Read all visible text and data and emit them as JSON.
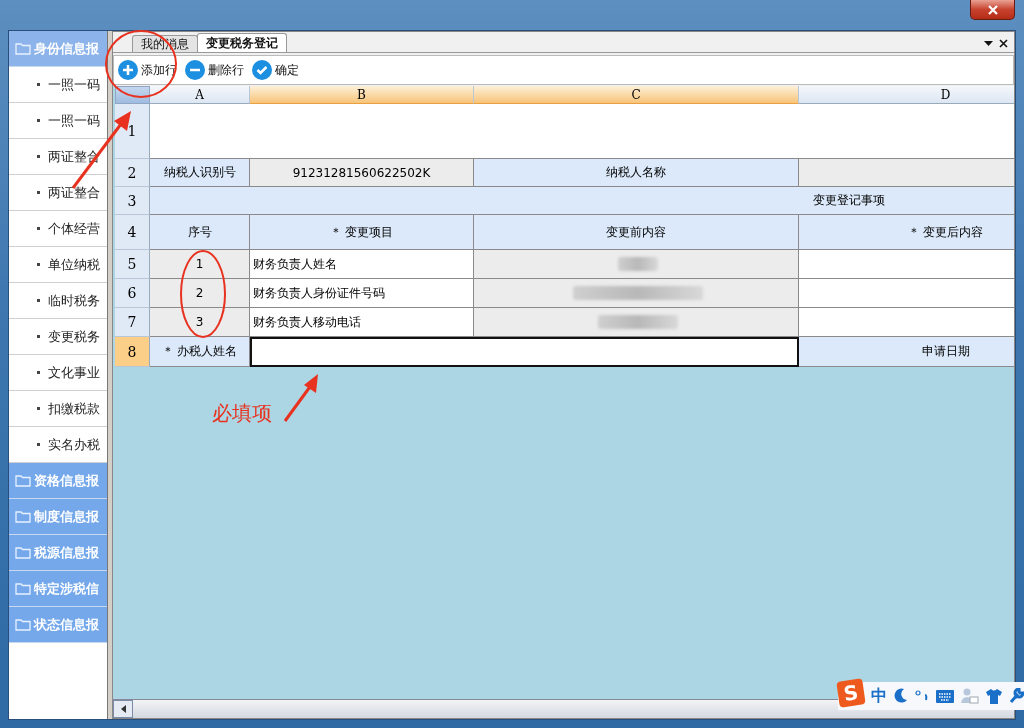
{
  "sidebar": {
    "groups": [
      {
        "label": "身份信息报",
        "expanded": true,
        "items": [
          "一照一码",
          "一照一码",
          "两证整合",
          "两证整合",
          "个体经营",
          "单位纳税",
          "临时税务",
          "变更税务",
          "文化事业",
          "扣缴税款",
          "实名办税"
        ]
      },
      {
        "label": "资格信息报",
        "expanded": false
      },
      {
        "label": "制度信息报",
        "expanded": false
      },
      {
        "label": "税源信息报",
        "expanded": false
      },
      {
        "label": "特定涉税信",
        "expanded": false
      },
      {
        "label": "状态信息报",
        "expanded": false
      }
    ]
  },
  "tabs": [
    {
      "label": "我的消息",
      "selected": false
    },
    {
      "label": "变更税务登记",
      "selected": true
    }
  ],
  "toolbar": [
    {
      "label": "添加行",
      "kind": "add"
    },
    {
      "label": "删除行",
      "kind": "remove"
    },
    {
      "label": "确定",
      "kind": "confirm"
    }
  ],
  "sheet": {
    "columns": [
      {
        "label": "A",
        "selected": false
      },
      {
        "label": "B",
        "selected": true
      },
      {
        "label": "C",
        "selected": true
      },
      {
        "label": "D",
        "selected": false
      }
    ],
    "rows": [
      {
        "label": "1",
        "selected": false,
        "cells": [
          {
            "kind": "blank"
          },
          {
            "kind": "merged"
          },
          {
            "kind": "merged"
          },
          {
            "kind": "merged"
          }
        ]
      },
      {
        "label": "2",
        "selected": false,
        "cells": [
          {
            "kind": "header",
            "text": "纳税人识别号"
          },
          {
            "kind": "data",
            "text": "91231281560622502K"
          },
          {
            "kind": "header",
            "text": "纳税人名称"
          },
          {
            "kind": "data"
          }
        ]
      },
      {
        "label": "3",
        "selected": false,
        "cells": [
          {
            "kind": "band"
          },
          {
            "kind": "merged"
          },
          {
            "kind": "merged"
          },
          {
            "kind": "title",
            "text": "变更登记事项"
          }
        ]
      },
      {
        "label": "4",
        "selected": false,
        "cells": [
          {
            "kind": "header",
            "text": "序号"
          },
          {
            "kind": "header",
            "text": "＊ 变更项目"
          },
          {
            "kind": "header",
            "text": "变更前内容"
          },
          {
            "kind": "header",
            "text": "＊ 变更后内容"
          }
        ]
      },
      {
        "label": "5",
        "selected": false,
        "cells": [
          {
            "kind": "data",
            "text": "1"
          },
          {
            "kind": "input",
            "text": "财务负责人姓名"
          },
          {
            "kind": "blurred"
          },
          {
            "kind": "input"
          }
        ]
      },
      {
        "label": "6",
        "selected": false,
        "cells": [
          {
            "kind": "data",
            "text": "2"
          },
          {
            "kind": "input",
            "text": "财务负责人身份证件号码"
          },
          {
            "kind": "blurred"
          },
          {
            "kind": "input"
          }
        ]
      },
      {
        "label": "7",
        "selected": false,
        "cells": [
          {
            "kind": "data",
            "text": "3"
          },
          {
            "kind": "input",
            "text": "财务负责人移动电话"
          },
          {
            "kind": "blurred"
          },
          {
            "kind": "input"
          }
        ]
      },
      {
        "label": "8",
        "selected": true,
        "cells": [
          {
            "kind": "header",
            "text": "＊ 办税人姓名"
          },
          {
            "kind": "active"
          },
          {
            "kind": "merged"
          },
          {
            "kind": "header",
            "text": "申请日期"
          }
        ]
      }
    ]
  },
  "annotation": {
    "text": "必填项"
  },
  "ime": {
    "logo": "S",
    "mode": "中"
  }
}
